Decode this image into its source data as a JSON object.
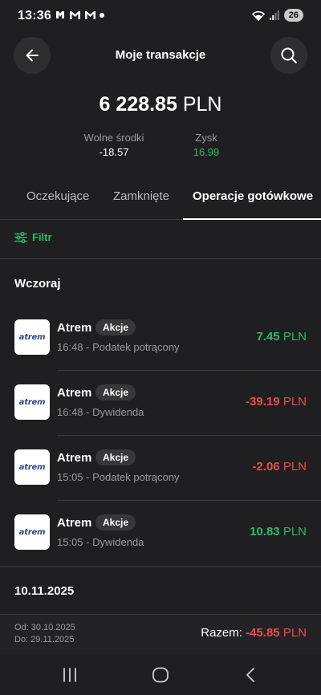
{
  "status": {
    "time": "13:36",
    "battery": "26"
  },
  "header": {
    "title": "Moje transakcje",
    "back_icon": "arrow-left-icon",
    "search_icon": "search-icon"
  },
  "summary": {
    "total_value": "6 228.85",
    "total_currency": "PLN",
    "free_funds_label": "Wolne środki",
    "free_funds_value": "-18.57",
    "profit_label": "Zysk",
    "profit_value": "16.99"
  },
  "tabs": [
    {
      "label": "Oczekujące"
    },
    {
      "label": "Zamknięte"
    },
    {
      "label": "Operacje gotówkowe",
      "active": true
    }
  ],
  "filter": {
    "label": "Filtr"
  },
  "sections": [
    {
      "title": "Wczoraj",
      "items": [
        {
          "logo": "atrem",
          "name": "Atrem",
          "badge": "Akcje",
          "subtitle": "16:48 - Podatek potrącony",
          "amount": "7.45",
          "currency": "PLN",
          "positive": true
        },
        {
          "logo": "atrem",
          "name": "Atrem",
          "badge": "Akcje",
          "subtitle": "16:48 - Dywidenda",
          "amount": "-39.19",
          "currency": "PLN",
          "positive": false
        },
        {
          "logo": "atrem",
          "name": "Atrem",
          "badge": "Akcje",
          "subtitle": "15:05 - Podatek potrącony",
          "amount": "-2.06",
          "currency": "PLN",
          "positive": false
        },
        {
          "logo": "atrem",
          "name": "Atrem",
          "badge": "Akcje",
          "subtitle": "15:05 - Dywidenda",
          "amount": "10.83",
          "currency": "PLN",
          "positive": true
        }
      ]
    },
    {
      "title": "10.11.2025",
      "items": []
    }
  ],
  "footer": {
    "from_label": "Od: 30.10.2025",
    "to_label": "Do: 29.11.2025",
    "total_label": "Razem:",
    "total_value": "-45.85",
    "total_currency": "PLN"
  },
  "colors": {
    "background": "#1f1f21",
    "positive": "#2fb86b",
    "negative": "#ee4b4b",
    "logo_text": "#2b4a8b"
  }
}
